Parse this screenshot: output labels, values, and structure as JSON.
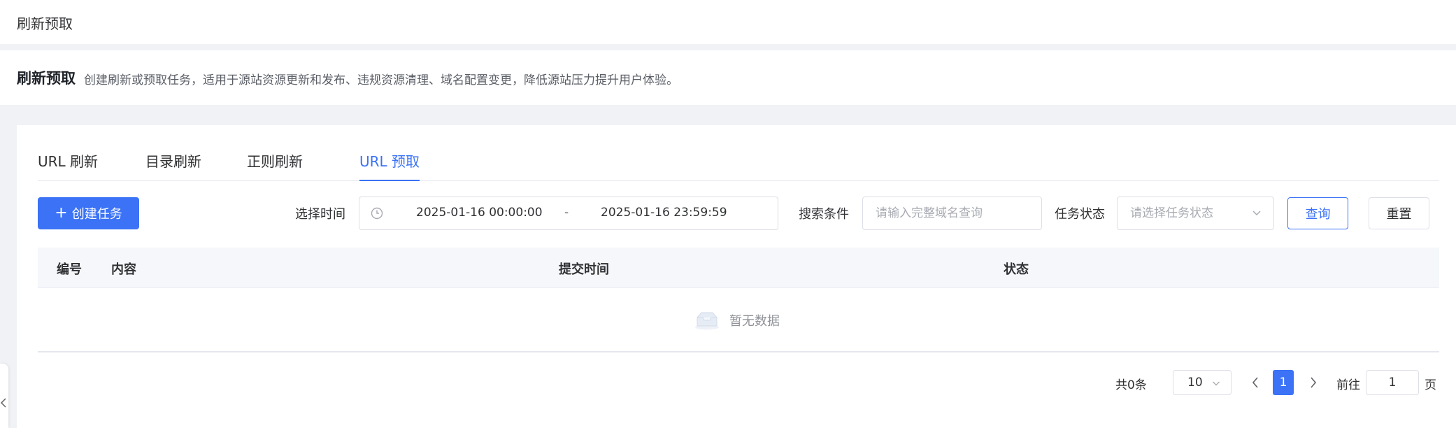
{
  "topbar": {
    "breadcrumb": "刷新预取"
  },
  "header": {
    "title": "刷新预取",
    "description": "创建刷新或预取任务，适用于源站资源更新和发布、违规资源清理、域名配置变更，降低源站压力提升用户体验。"
  },
  "tabs": [
    {
      "label": "URL 刷新",
      "active": false
    },
    {
      "label": "目录刷新",
      "active": false
    },
    {
      "label": "正则刷新",
      "active": false
    },
    {
      "label": "URL 预取",
      "active": true
    }
  ],
  "toolbar": {
    "create_label": "创建任务",
    "time_label": "选择时间",
    "start_time": "2025-01-16 00:00:00",
    "range_separator": "-",
    "end_time": "2025-01-16 23:59:59",
    "search_label": "搜索条件",
    "search_placeholder": "请输入完整域名查询",
    "status_label": "任务状态",
    "status_placeholder": "请选择任务状态",
    "query_label": "查询",
    "reset_label": "重置"
  },
  "table": {
    "columns": [
      "编号",
      "内容",
      "提交时间",
      "状态"
    ],
    "rows": [],
    "empty_text": "暂无数据"
  },
  "pagination": {
    "total_text": "共0条",
    "page_size": "10",
    "current_page": "1",
    "goto_label": "前往",
    "goto_value": "1",
    "goto_suffix": "页"
  },
  "colors": {
    "primary": "#3b72f6",
    "page_bg": "#f0f2f5",
    "border": "#dcdfe6"
  }
}
